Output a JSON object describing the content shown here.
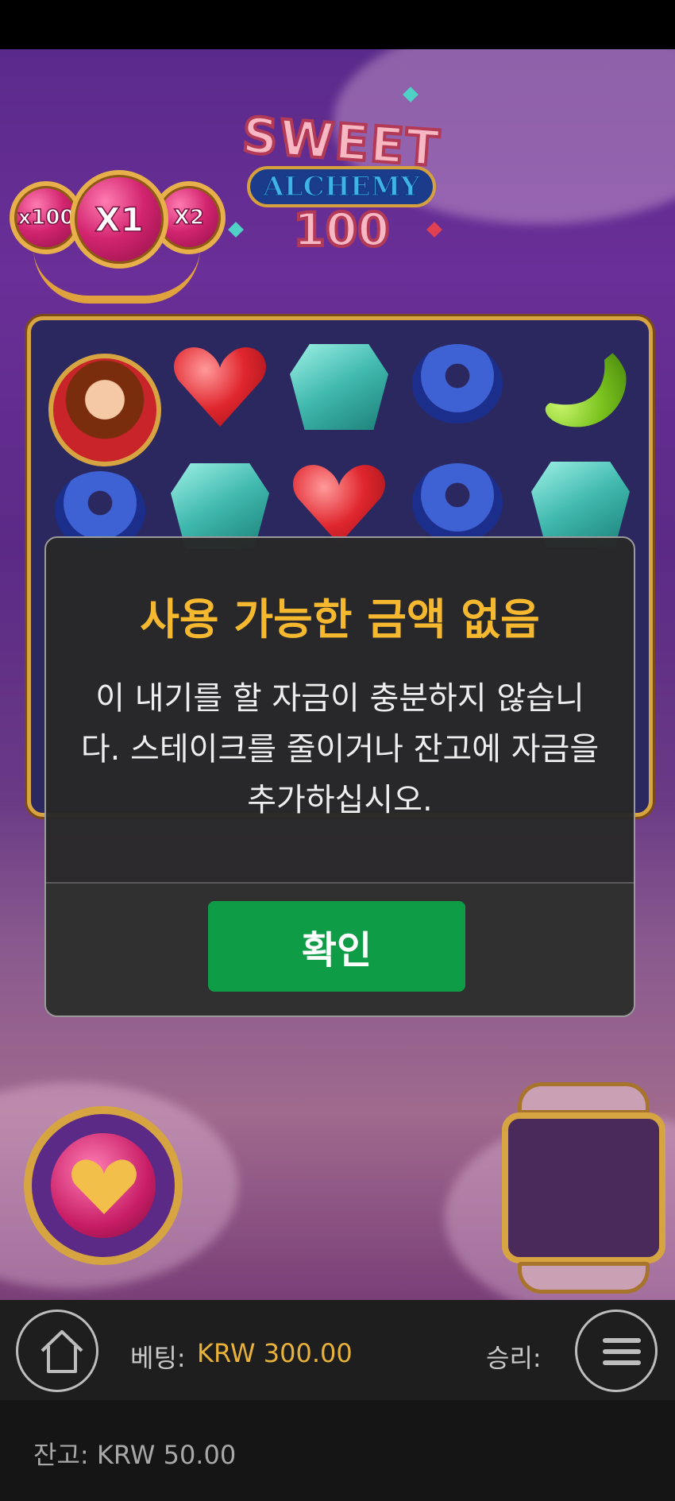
{
  "logo": {
    "line1": "SWEET",
    "line2": "ALCHEMY",
    "line3": "100"
  },
  "multipliers": {
    "left": "x100",
    "center": "X1",
    "right": "X2"
  },
  "modal": {
    "title": "사용 가능한 금액 없음",
    "message": "이 내기를 할 자금이 충분하지 않습니다. 스테이크를 줄이거나 잔고에 자금을 추가하십시오.",
    "ok_label": "확인"
  },
  "hud": {
    "bet_label": "베팅:",
    "bet_value": "KRW 300.00",
    "win_label": "승리:",
    "balance_label": "잔고:",
    "balance_value": "KRW 50.00",
    "home_icon": "home-icon",
    "menu_icon": "hamburger-menu-icon"
  },
  "colors": {
    "title_accent": "#f5b82e",
    "ok_button": "#0e9c47",
    "bet_value": "#e8b23a"
  }
}
